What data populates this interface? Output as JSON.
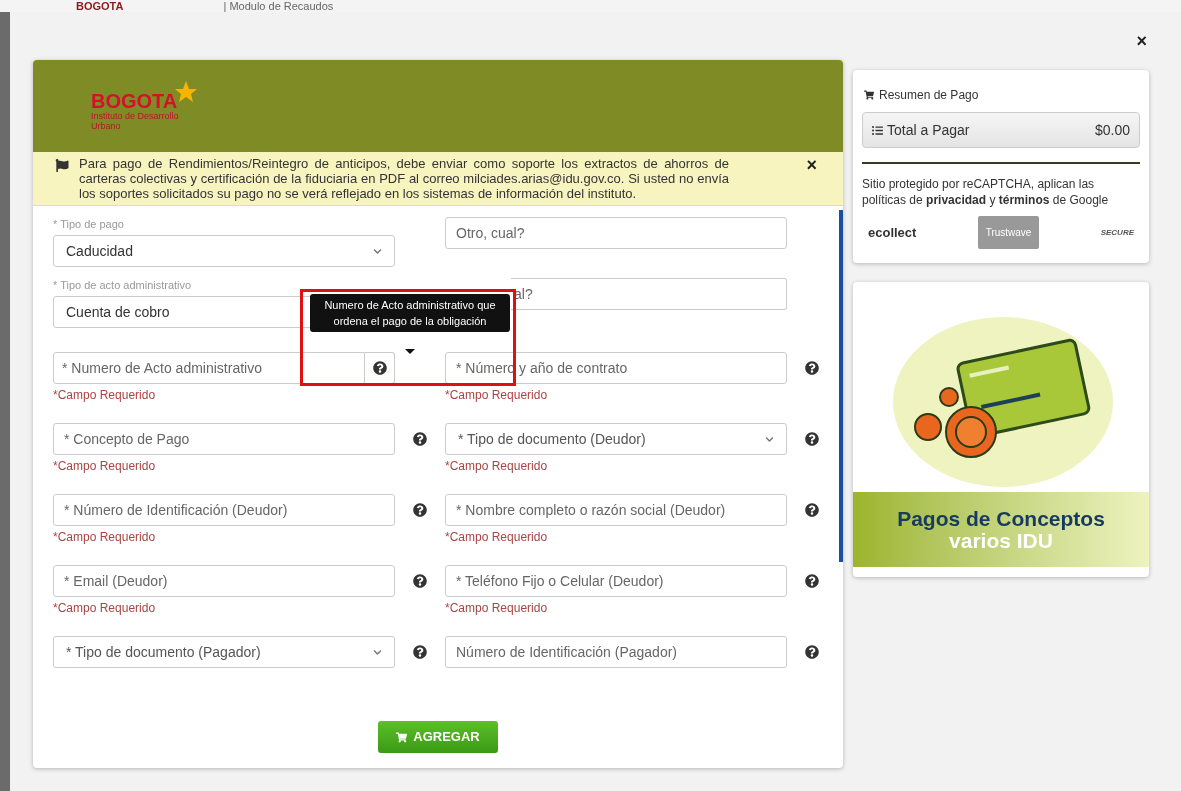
{
  "background_header": {
    "logo": "BOGOTA",
    "title": "| Modulo de Recaudos"
  },
  "notice": {
    "text": "Para pago de Rendimientos/Reintegro de anticipos, debe enviar como soporte los extractos de ahorros de carteras colectivas y certificación de la fiduciaria en PDF al correo milciades.arias@idu.gov.co. Si usted no envía los soportes solicitados su pago no se verá reflejado en los sistemas de información del instituto.",
    "close": "×"
  },
  "logo": {
    "name": "BOGOTA",
    "subtitle": "Instituto de Desarrollo Urbano"
  },
  "form_rows": [
    [
      {
        "kind": "select",
        "label": "* Tipo de pago",
        "value": "Caducidad",
        "help": false
      },
      {
        "kind": "input",
        "placeholder": "Otro, cual?",
        "help": false
      }
    ],
    [
      {
        "kind": "select_covered",
        "label": "* Tipo de acto administrativo",
        "value": "Cuenta de cobro",
        "help": false
      },
      {
        "kind": "input_covered",
        "placeholder": "al?",
        "help": false
      }
    ],
    [
      {
        "kind": "input_addon",
        "placeholder": "* Numero de Acto administrativo",
        "help": true,
        "error": "*Campo Requerido"
      },
      {
        "kind": "input",
        "placeholder": "* Número y año de contrato",
        "help": true,
        "error": "*Campo Requerido"
      }
    ],
    [
      {
        "kind": "input",
        "placeholder": "* Concepto de Pago",
        "help": true,
        "error": "*Campo Requerido"
      },
      {
        "kind": "select",
        "placeholder": "* Tipo de documento (Deudor)",
        "help": true,
        "error": "*Campo Requerido"
      }
    ],
    [
      {
        "kind": "input",
        "placeholder": "* Número de Identificación (Deudor)",
        "help": true,
        "error": "*Campo Requerido"
      },
      {
        "kind": "input",
        "placeholder": "* Nombre completo o razón social (Deudor)",
        "help": true,
        "error": "*Campo Requerido"
      }
    ],
    [
      {
        "kind": "input",
        "placeholder": "* Email (Deudor)",
        "help": true,
        "error": "*Campo Requerido"
      },
      {
        "kind": "input",
        "placeholder": "* Teléfono Fijo o Celular (Deudor)",
        "help": true,
        "error": "*Campo Requerido"
      }
    ],
    [
      {
        "kind": "select",
        "placeholder": "* Tipo de documento (Pagador)",
        "help": true
      },
      {
        "kind": "input",
        "placeholder": "Número de Identificación (Pagador)",
        "help": true
      }
    ]
  ],
  "tooltip": "Numero de Acto administrativo que ordena el pago de la obligación",
  "add_button": "AGREGAR",
  "summary": {
    "title": "Resumen de Pago",
    "total_label": "Total a Pagar",
    "total_value": "$0.00",
    "recaptcha_text": "Sitio protegido por reCAPTCHA, aplican las políticas de **privacidad** y **términos** de Google",
    "badges": [
      "ecollect",
      "Trustwave",
      "SECURE"
    ]
  },
  "banner": {
    "title": "Pagos de Conceptos",
    "subtitle": "varios IDU"
  },
  "modal_close": "×"
}
